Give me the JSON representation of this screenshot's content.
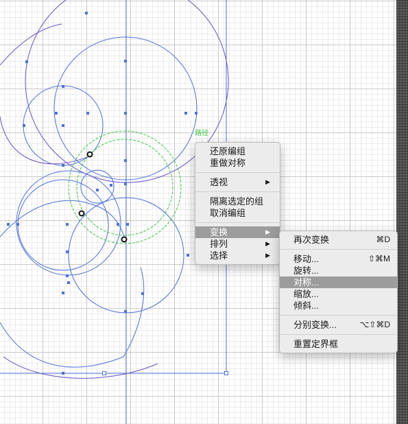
{
  "canvas": {
    "path_label": "路径"
  },
  "context_menu": {
    "items": [
      {
        "label": "还原编组"
      },
      {
        "label": "重做对称"
      },
      {
        "separator": true
      },
      {
        "label": "透视",
        "arrow": "▶"
      },
      {
        "separator": true
      },
      {
        "label": "隔离选定的组"
      },
      {
        "label": "取消编组"
      },
      {
        "separator": true
      },
      {
        "label": "变换",
        "arrow": "▶",
        "highlighted": true
      },
      {
        "label": "排列",
        "arrow": "▶"
      },
      {
        "label": "选择",
        "arrow": "▶"
      }
    ]
  },
  "transform_submenu": {
    "items": [
      {
        "label": "再次变换",
        "shortcut": "⌘D"
      },
      {
        "separator": true
      },
      {
        "label": "移动...",
        "shortcut": "⇧⌘M"
      },
      {
        "label": "旋转..."
      },
      {
        "label": "对称...",
        "highlighted": true
      },
      {
        "label": "缩放..."
      },
      {
        "label": "倾斜..."
      },
      {
        "separator": true
      },
      {
        "label": "分别变换...",
        "shortcut": "⌥⇧⌘D"
      },
      {
        "separator": true
      },
      {
        "label": "重置定界框"
      }
    ]
  },
  "colors": {
    "path_blue": "#4a72dc",
    "path_purple": "#6a4fc8",
    "guide_green": "#39c939",
    "menu_highlight": "#9c9c9c"
  }
}
